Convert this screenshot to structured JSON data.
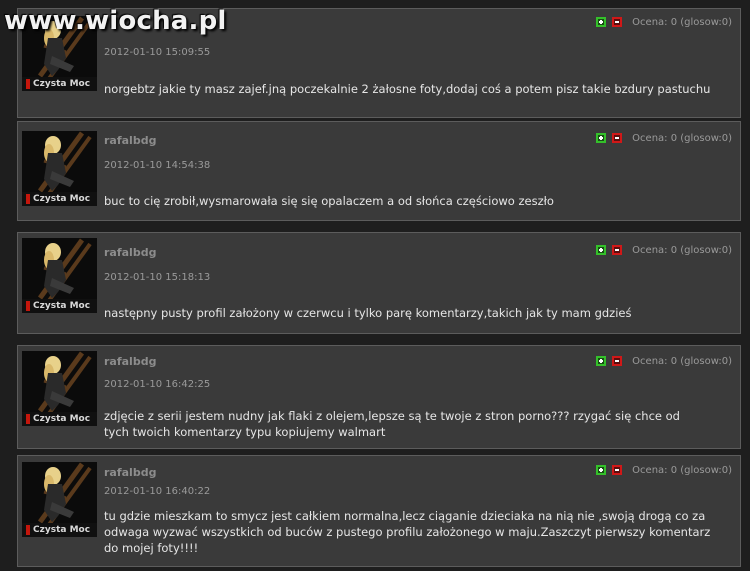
{
  "site": {
    "watermark": "www.wiocha.pl"
  },
  "comments": [
    {
      "author": "",
      "date": "2012-01-10 15:09:55",
      "rating": "Ocena: 0 (glosow:0)",
      "badge": "Czysta Moc",
      "text": "norgebtz jakie ty masz zajef.jną poczekalnie 2 żałosne foty,dodaj coś a potem pisz takie bzdury pastuchu"
    },
    {
      "author": "rafalbdg",
      "date": "2012-01-10 14:54:38",
      "rating": "Ocena: 0 (glosow:0)",
      "badge": "Czysta Moc",
      "text": "buc to cię zrobił,wysmarowała się się opalaczem a od słońca częściowo zeszło"
    },
    {
      "author": "rafalbdg",
      "date": "2012-01-10 15:18:13",
      "rating": "Ocena: 0 (glosow:0)",
      "badge": "Czysta Moc",
      "text": "następny pusty profil założony w czerwcu i tylko parę komentarzy,takich jak ty mam gdzieś"
    },
    {
      "author": "rafalbdg",
      "date": "2012-01-10 16:42:25",
      "rating": "Ocena: 0 (glosow:0)",
      "badge": "Czysta Moc",
      "text": "zdjęcie z serii jestem nudny jak flaki z olejem,lepsze są te twoje z stron porno??? rzygać się chce od tych twoich komentarzy typu kopiujemy walmart"
    },
    {
      "author": "rafalbdg",
      "date": "2012-01-10 16:40:22",
      "rating": "Ocena: 0 (glosow:0)",
      "badge": "Czysta Moc",
      "text": "tu gdzie mieszkam to smycz jest całkiem normalna,lecz ciąganie dzieciaka na nią nie ,swoją drogą co za odwaga wyzwać wszystkich od buców z pustego profilu założonego w maju.Zaszczyt pierwszy komentarz do mojej foty!!!!"
    }
  ]
}
